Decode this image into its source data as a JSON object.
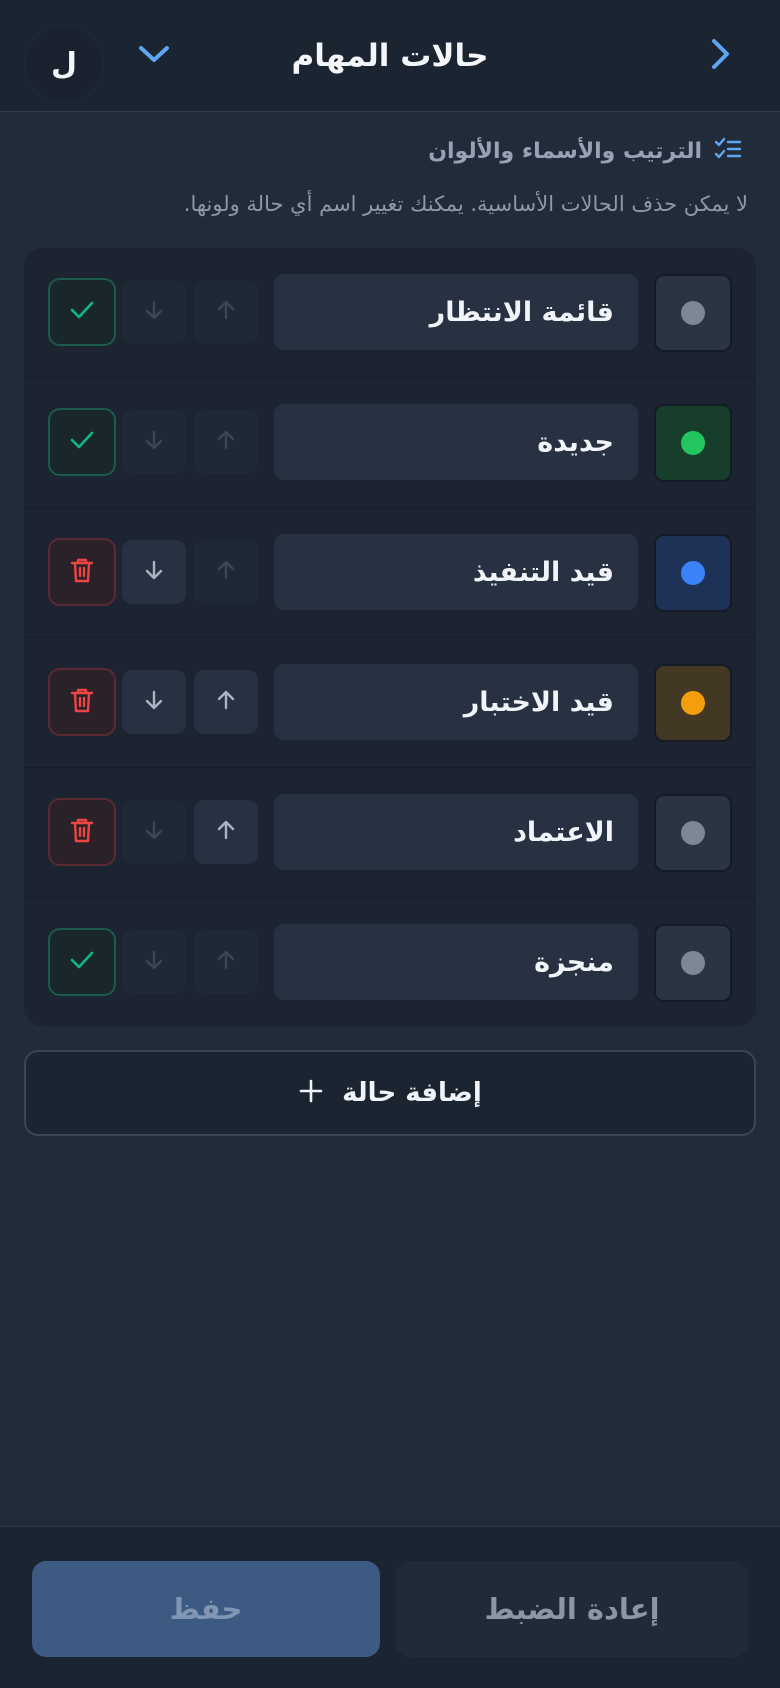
{
  "header": {
    "title": "حالات المهام",
    "avatar_initial": "ل",
    "icons": {
      "back": "chevron-right-icon",
      "menu": "chevron-down-icon"
    },
    "accent_color": "#5ea5f2"
  },
  "section": {
    "heading": "الترتيب والأسماء والألوان",
    "heading_icon": "list-checks-icon",
    "description": "لا يمكن حذف الحالات الأساسية. يمكنك تغيير اسم أي حالة ولونها."
  },
  "statuses": [
    {
      "name": "قائمة الانتظار",
      "dot_color": "#7d8796",
      "swatch_bg": "#2b3442",
      "can_move_up": false,
      "can_move_down": false,
      "action": "check"
    },
    {
      "name": "جديدة",
      "dot_color": "#22c55e",
      "swatch_bg": "#173d2b",
      "can_move_up": false,
      "can_move_down": false,
      "action": "check"
    },
    {
      "name": "قيد التنفيذ",
      "dot_color": "#3b82f6",
      "swatch_bg": "#1e3257",
      "can_move_up": false,
      "can_move_down": true,
      "action": "delete"
    },
    {
      "name": "قيد الاختبار",
      "dot_color": "#f59e0b",
      "swatch_bg": "#433823",
      "can_move_up": true,
      "can_move_down": true,
      "action": "delete"
    },
    {
      "name": "الاعتماد",
      "dot_color": "#7d8796",
      "swatch_bg": "#2b3442",
      "can_move_up": true,
      "can_move_down": false,
      "action": "delete"
    },
    {
      "name": "منجزة",
      "dot_color": "#7d8796",
      "swatch_bg": "#2b3442",
      "can_move_up": false,
      "can_move_down": false,
      "action": "check"
    }
  ],
  "colors": {
    "check": "#10b981",
    "delete": "#ef4444",
    "arrow_enabled": "#aab4c2",
    "arrow_disabled": "#3b4657"
  },
  "add_button": {
    "label": "إضافة حالة",
    "icon": "plus-icon"
  },
  "footer": {
    "reset_label": "إعادة الضبط",
    "save_label": "حفظ"
  }
}
